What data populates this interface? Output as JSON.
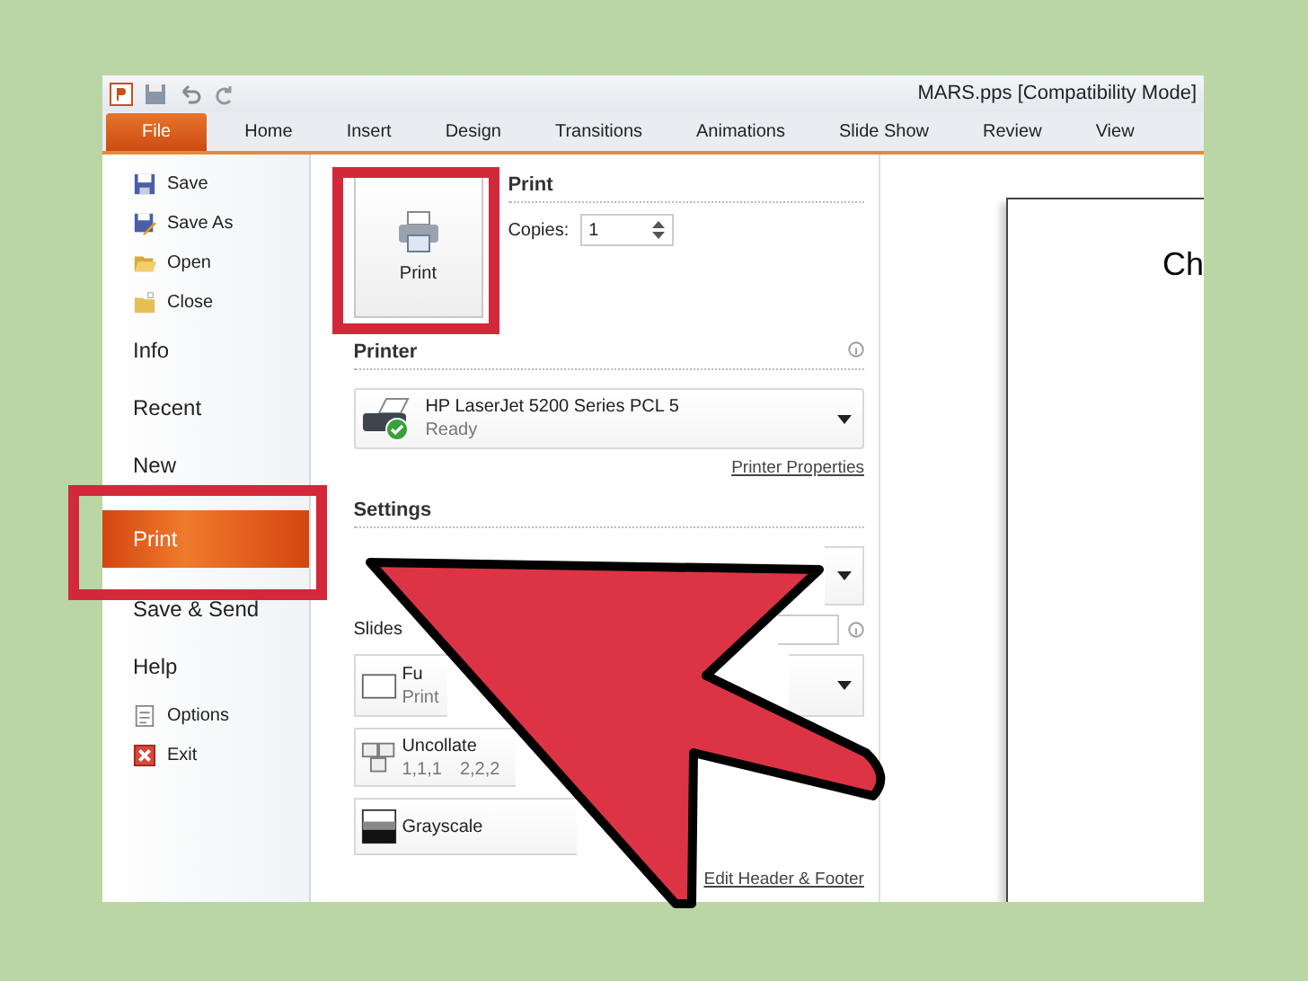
{
  "window": {
    "title": "MARS.pps [Compatibility Mode]"
  },
  "ribbon_tabs": [
    {
      "label": "File",
      "selected": true
    },
    {
      "label": "Home",
      "selected": false
    },
    {
      "label": "Insert",
      "selected": false
    },
    {
      "label": "Design",
      "selected": false
    },
    {
      "label": "Transitions",
      "selected": false
    },
    {
      "label": "Animations",
      "selected": false
    },
    {
      "label": "Slide Show",
      "selected": false
    },
    {
      "label": "Review",
      "selected": false
    },
    {
      "label": "View",
      "selected": false
    }
  ],
  "backstage_nav": [
    {
      "label": "Save",
      "kind": "save",
      "selected": false
    },
    {
      "label": "Save As",
      "kind": "save_as",
      "selected": false
    },
    {
      "label": "Open",
      "kind": "open",
      "selected": false
    },
    {
      "label": "Close",
      "kind": "close",
      "selected": false
    },
    {
      "label": "Info",
      "kind": "section",
      "selected": false
    },
    {
      "label": "Recent",
      "kind": "section",
      "selected": false
    },
    {
      "label": "New",
      "kind": "section",
      "selected": false
    },
    {
      "label": "Print",
      "kind": "section",
      "selected": true
    },
    {
      "label": "Save & Send",
      "kind": "section",
      "selected": false
    },
    {
      "label": "Help",
      "kind": "section",
      "selected": false
    },
    {
      "label": "Options",
      "kind": "options",
      "selected": false
    },
    {
      "label": "Exit",
      "kind": "exit",
      "selected": false
    }
  ],
  "print": {
    "button": "Print",
    "heading": "Print",
    "copies_label": "Copies:",
    "copies": "1"
  },
  "printer": {
    "heading": "Printer",
    "name": "HP LaserJet 5200 Series PCL 5",
    "status": "Ready",
    "properties_link": "Printer Properties"
  },
  "settings": {
    "heading": "Settings",
    "slides_label": "Slides",
    "options": [
      {
        "kind": "blank",
        "dropdown": true
      },
      {
        "kind": "layout",
        "title": "Fu",
        "subtitle": "Print",
        "dropdown": true
      },
      {
        "kind": "collate",
        "title": "Uncollate",
        "subtitle": "1,1,1",
        "subtitle_2": "2,2,2",
        "dropdown": false
      },
      {
        "kind": "color",
        "title": "Grayscale",
        "dropdown": false
      }
    ],
    "footer_link": "Edit Header & Footer"
  },
  "preview": {
    "text": "Ch"
  }
}
